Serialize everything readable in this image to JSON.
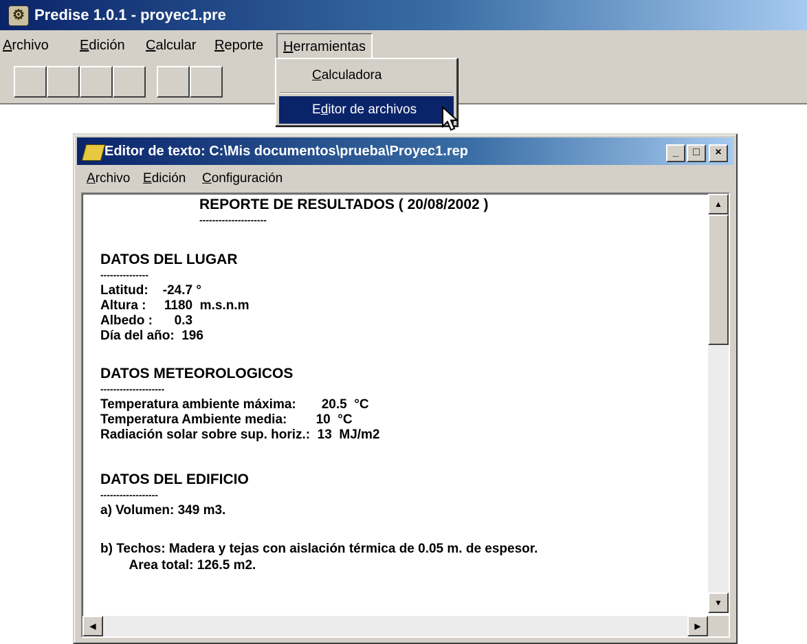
{
  "app": {
    "title": "Predise 1.0.1 - proyec1.pre",
    "menu": [
      {
        "first": "A",
        "rest": "rchivo"
      },
      {
        "first": "E",
        "rest": "dición"
      },
      {
        "first": "C",
        "rest": "alcular"
      },
      {
        "first": "R",
        "rest": "eporte"
      },
      {
        "first": "H",
        "rest": "erramientas"
      }
    ]
  },
  "dropdown": {
    "calc": {
      "first": "C",
      "rest": "alculadora"
    },
    "editor": {
      "pre": "E",
      "ul": "d",
      "rest": "itor de archivos"
    }
  },
  "editor": {
    "title": "Editor de texto: C:\\Mis documentos\\prueba\\Proyec1.rep",
    "menu": [
      {
        "first": "A",
        "rest": "rchivo"
      },
      {
        "first": "E",
        "rest": "dición"
      },
      {
        "first": "C",
        "rest": "onfiguración"
      }
    ],
    "lines": {
      "report_title": "REPORTE DE RESULTADOS ( 20/08/2002 )",
      "report_dash": "---------------------",
      "lugar_h": "DATOS DEL LUGAR",
      "lugar_dash": "---------------",
      "latitud": "Latitud:    -24.7 °",
      "altura": "Altura :     1180  m.s.n.m",
      "albedo": "Albedo :      0.3",
      "dia": "Día del año:  196",
      "meteo_h": "DATOS METEOROLOGICOS",
      "meteo_dash": "--------------------",
      "tmax": "Temperatura ambiente máxima:       20.5  °C",
      "tmed": "Temperatura Ambiente media:        10  °C",
      "rad": "Radiación solar sobre sup. horiz.:  13  MJ/m2",
      "edif_h": "DATOS DEL EDIFICIO",
      "edif_dash": "------------------",
      "vol": "a) Volumen: 349 m3.",
      "techos": "b) Techos: Madera y tejas con aislación térmica de 0.05 m. de espesor.",
      "area": "        Area total: 126.5 m2."
    }
  }
}
